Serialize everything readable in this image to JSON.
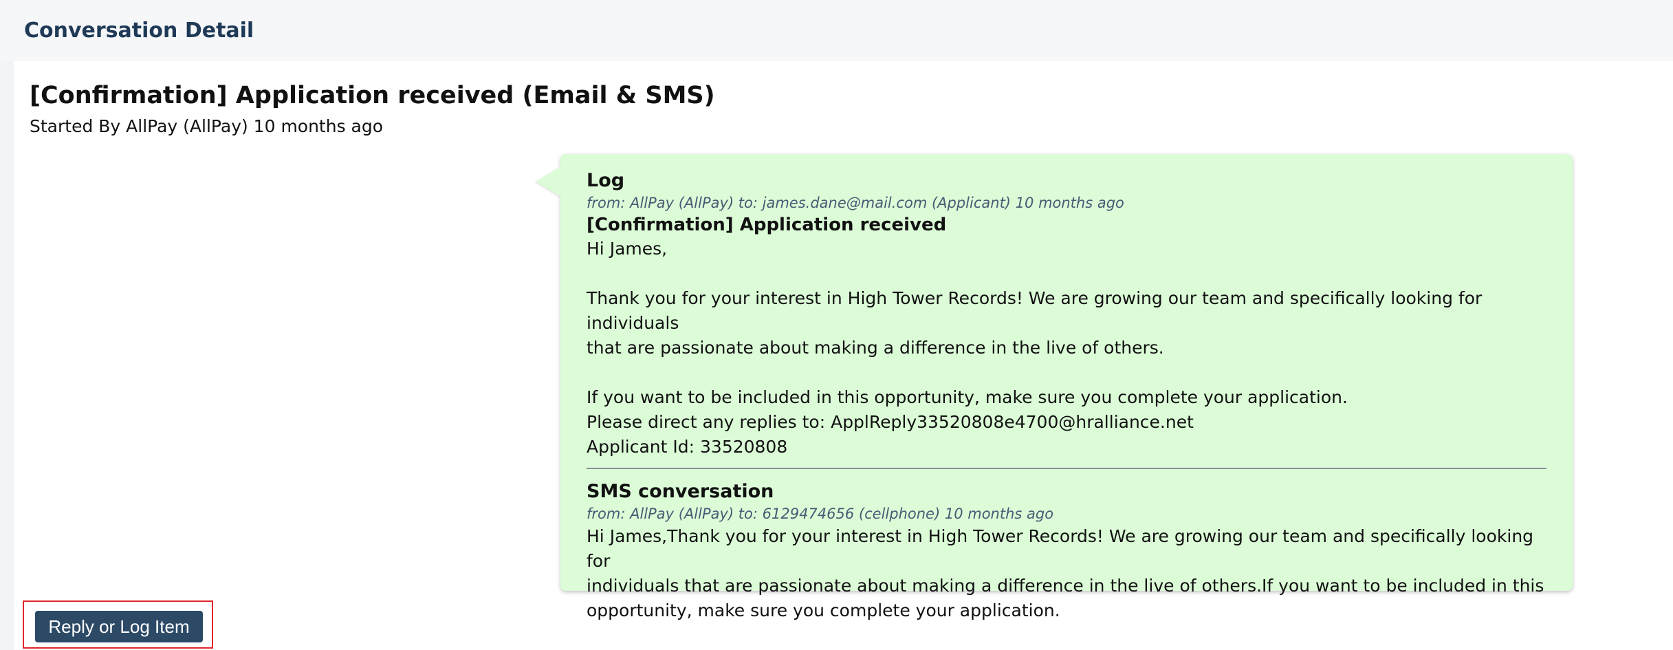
{
  "header": {
    "title": "Conversation Detail"
  },
  "conversation": {
    "title": "[Confirmation] Application received (Email & SMS)",
    "started_by": "Started By AllPay (AllPay) 10 months ago"
  },
  "messages": [
    {
      "type_label": "Log",
      "meta": "from: AllPay (AllPay) to: james.dane@mail.com (Applicant) 10 months ago",
      "subject": "[Confirmation] Application received",
      "greeting": "Hi James,",
      "para1_line1": "Thank you for your interest in High Tower Records! We are growing our team and specifically looking for individuals",
      "para1_line2": "that are passionate about making a difference in the live of others.",
      "para2_line1": "If you want to be included in this opportunity, make sure you complete your application.",
      "para2_line2": "Please direct any replies to: ApplReply33520808e4700@hralliance.net",
      "para2_line3": "Applicant Id: 33520808"
    },
    {
      "type_label": "SMS conversation",
      "meta": "from: AllPay (AllPay) to: 6129474656 (cellphone) 10 months ago",
      "body_line1": "Hi James,Thank you for your interest in High Tower Records! We are growing our team and specifically looking for",
      "body_line2": "individuals that are passionate about making a difference in the live of others.If you want to be included in this",
      "body_line3": "opportunity, make sure you complete your application."
    }
  ],
  "actions": {
    "reply_label": "Reply or Log Item"
  },
  "colors": {
    "header_text": "#1f3a57",
    "bubble_bg": "#dcfcd8",
    "button_bg": "#2c4a66",
    "highlight_border": "#e0262c"
  }
}
